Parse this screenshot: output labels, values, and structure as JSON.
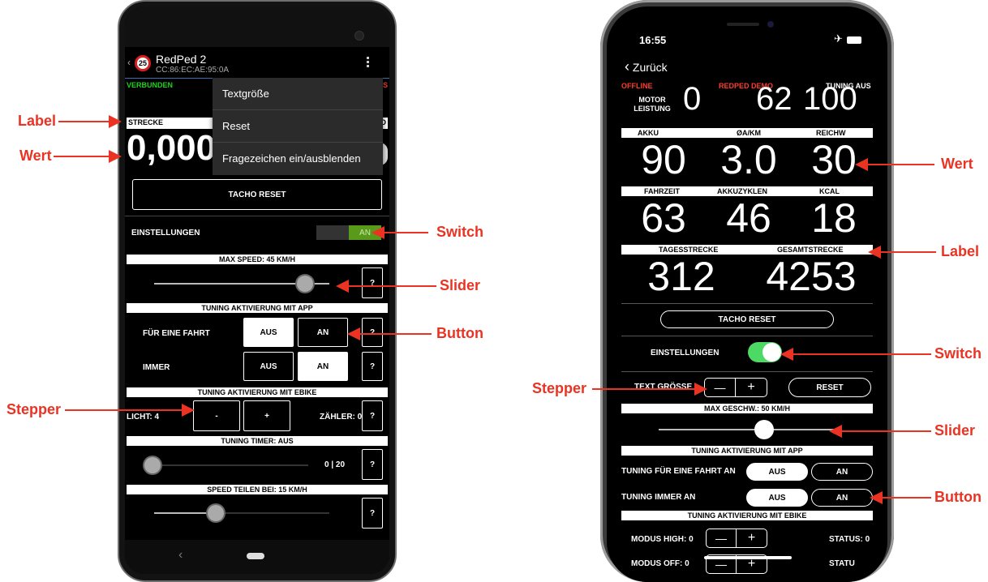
{
  "colors": {
    "annotation": "#ea3323",
    "connected": "#1bd41b",
    "offline": "#ff3b30",
    "switch_green": "#4cd964",
    "switch_android": "#5a9a1a"
  },
  "annotations": {
    "left": {
      "label": "Label",
      "wert": "Wert",
      "switch": "Switch",
      "slider": "Slider",
      "button": "Button",
      "stepper": "Stepper"
    },
    "right": {
      "wert": "Wert",
      "label": "Label",
      "switch": "Switch",
      "stepper": "Stepper",
      "slider": "Slider",
      "button": "Button"
    }
  },
  "android": {
    "header": {
      "title": "RedPed 2",
      "subtitle": "CC:86:EC:AE:95:0A",
      "badge": "25"
    },
    "status": {
      "connected": "VERBUNDEN",
      "right_char": "S"
    },
    "menu": [
      "Textgröße",
      "Reset",
      "Fragezeichen ein/ausblenden"
    ],
    "strecke_label": "STRECKE",
    "strecke_right_label": "D",
    "strecke_value": "0,000",
    "tacho_reset": "TACHO RESET",
    "settings_label": "EINSTELLUNGEN",
    "switch_text": "AN",
    "max_speed": "MAX SPEED: 45 KM/H",
    "max_speed_fraction": 0.86,
    "tuning_app": "TUNING AKTIVIERUNG MIT APP",
    "ride_label": "FÜR EINE FAHRT",
    "always_label": "IMMER",
    "aus": "AUS",
    "an": "AN",
    "question": "?",
    "tuning_ebike": "TUNING AKTIVIERUNG MIT EBIKE",
    "licht": "LICHT: 4",
    "minus": "-",
    "plus": "+",
    "zaehler": "ZÄHLER: 0",
    "timer": "TUNING TIMER: AUS",
    "timer_value": "0 | 20",
    "speed_teilen": "SPEED TEILEN BEI: 15 KM/H",
    "nav_back": "‹"
  },
  "ios": {
    "time": "16:55",
    "back": "Zurück",
    "status": {
      "offline": "OFFLINE",
      "demo": "REDPED DEMO",
      "tuning": "TUNING AUS"
    },
    "motor_label": "MOTOR LEISTUNG",
    "motor_values": [
      "0",
      "62",
      "100"
    ],
    "row1_labels": [
      "AKKU",
      "ØA/KM",
      "REICHW"
    ],
    "row1_values": [
      "90",
      "3.0",
      "30"
    ],
    "row2_labels": [
      "FAHRZEIT",
      "AKKUZYKLEN",
      "KCAL"
    ],
    "row2_values": [
      "63",
      "46",
      "18"
    ],
    "row3_labels": [
      "TAGESSTRECKE",
      "GESAMTSTRECKE"
    ],
    "row3_values": [
      "312",
      "4253"
    ],
    "tacho_reset": "TACHO RESET",
    "settings_label": "EINSTELLUNGEN",
    "text_size": "TEXT GRÖSSE",
    "reset": "RESET",
    "max_speed": "MAX GESCHW.: 50 KM/H",
    "max_speed_fraction": 0.6,
    "tuning_app": "TUNING AKTIVIERUNG MIT APP",
    "ride_label": "TUNING FÜR EINE FAHRT AN",
    "always_label": "TUNING IMMER AN",
    "aus": "AUS",
    "an": "AN",
    "tuning_ebike": "TUNING AKTIVIERUNG MIT EBIKE",
    "modus_high": "MODUS HIGH: 0",
    "status_label": "STATUS: 0",
    "modus_off": "MODUS OFF: 0",
    "status_cut": "STATU",
    "minus": "—",
    "plus": "+"
  }
}
